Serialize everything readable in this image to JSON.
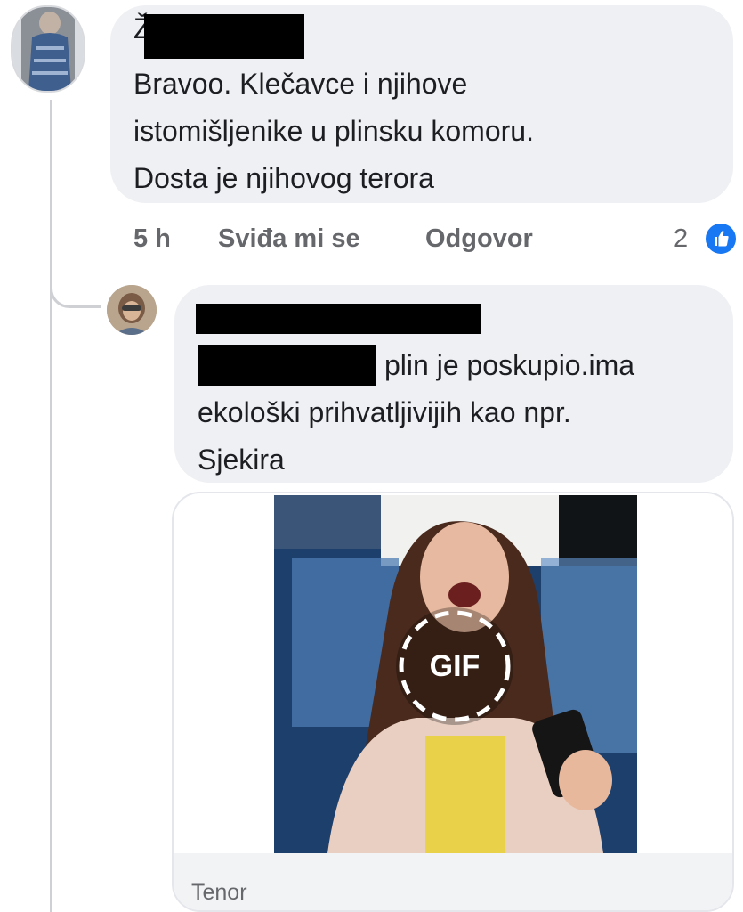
{
  "comments": [
    {
      "author_visible": "Ž",
      "lines": [
        "Bravoo. Klečavce i njihove",
        "istomišljenike u plinsku komoru.",
        "Dosta je njihovog terora"
      ],
      "timestamp": "5 h",
      "like_label": "Sviđa mi se",
      "reply_label": "Odgovor",
      "reaction_count": "2",
      "reaction_icon": "thumbs-up-icon"
    }
  ],
  "reply": {
    "lines": [
      "plin je poskupio.ima",
      "ekološki prihvatljivijih kao npr.",
      "Sjekira"
    ],
    "gif": {
      "badge": "GIF",
      "source": "Tenor"
    }
  },
  "colors": {
    "bubble": "#eff0f3",
    "meta_text": "#65676b",
    "like_blue": "#1877f2",
    "thread_line": "#ced0d4"
  }
}
